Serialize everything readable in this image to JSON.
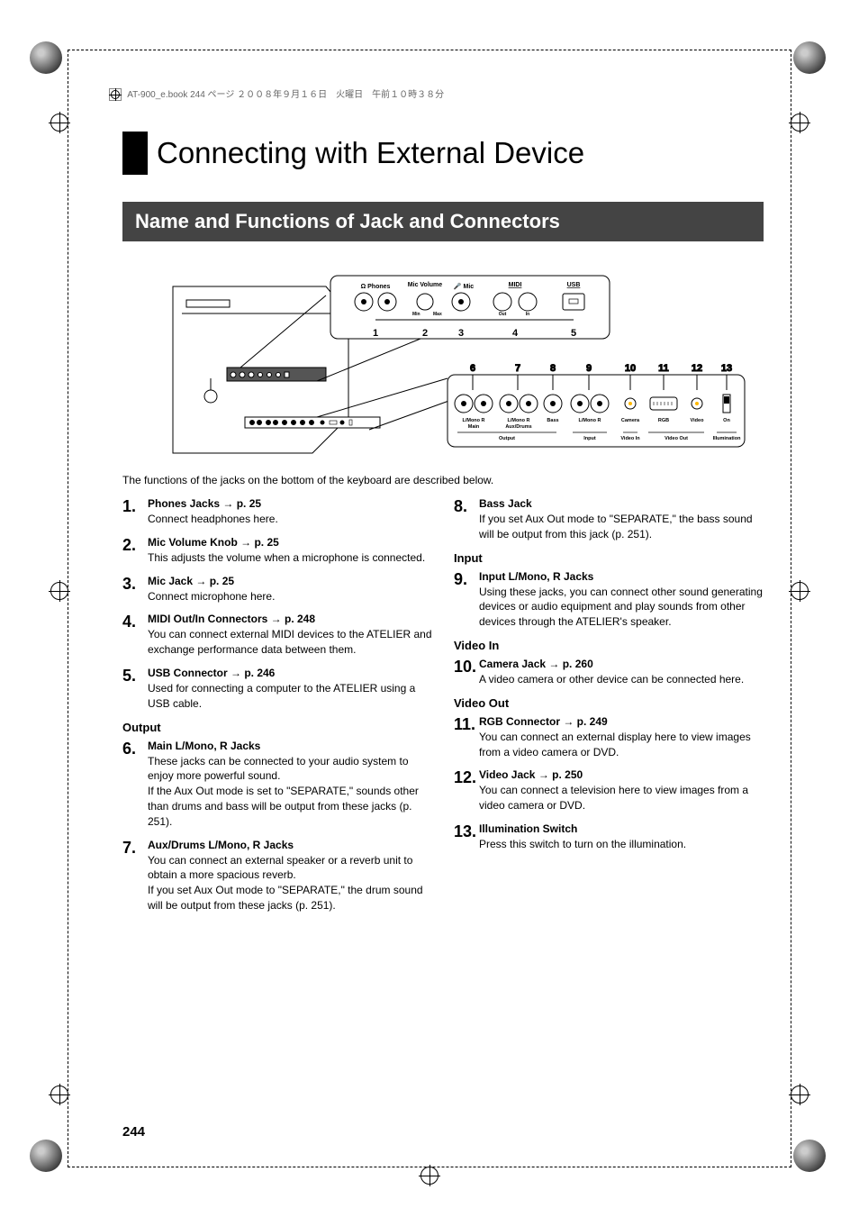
{
  "header": "AT-900_e.book  244 ページ  ２００８年９月１６日　火曜日　午前１０時３８分",
  "chapterTitle": "Connecting with External Device",
  "sectionBanner": "Name and Functions of Jack and Connectors",
  "diagram": {
    "topLabels": [
      "Phones",
      "Mic Volume",
      "Mic",
      "MIDI",
      "USB"
    ],
    "topNumbers": [
      "1",
      "2",
      "3",
      "4",
      "5"
    ],
    "bottomNumbers": [
      "6",
      "7",
      "8",
      "9",
      "10",
      "11",
      "12",
      "13"
    ],
    "bottomLabels": {
      "main": "L/Mono    R",
      "mainSub": "Main",
      "aux": "L/Mono    R",
      "auxSub": "Aux/Drums",
      "bass": "Bass",
      "input": "L/Mono    R",
      "camera": "Camera",
      "rgb": "RGB",
      "video": "Video",
      "illum": "On",
      "outputGroup": "Output",
      "inputGroup": "Input",
      "videoIn": "Video In",
      "videoOut": "Video Out",
      "illumination": "Illumination"
    }
  },
  "caption": "The functions of the jacks on the bottom of the keyboard are described below.",
  "leftItems": [
    {
      "num": "1.",
      "title": "Phones Jacks → p. 25",
      "desc": "Connect headphones here."
    },
    {
      "num": "2.",
      "title": "Mic Volume Knob → p. 25",
      "desc": "This adjusts the volume when a microphone is connected."
    },
    {
      "num": "3.",
      "title": "Mic Jack → p. 25",
      "desc": "Connect microphone here."
    },
    {
      "num": "4.",
      "title": "MIDI Out/In Connectors → p. 248",
      "desc": "You can connect external MIDI devices to the ATELIER and exchange performance data between them."
    },
    {
      "num": "5.",
      "title": "USB Connector → p. 246",
      "desc": "Used for connecting a computer to the ATELIER using a USB cable."
    }
  ],
  "leftGroup": "Output",
  "leftItems2": [
    {
      "num": "6.",
      "title": "Main L/Mono, R Jacks",
      "desc": "These jacks can be connected to your audio system to enjoy more powerful sound.\nIf the Aux Out mode is set to \"SEPARATE,\" sounds other than drums and bass will be output from these jacks (p. 251)."
    },
    {
      "num": "7.",
      "title": "Aux/Drums L/Mono, R Jacks",
      "desc": "You can connect an external speaker or a reverb unit to obtain a more spacious reverb.\nIf you set Aux Out mode to \"SEPARATE,\" the drum sound will be output from these jacks (p. 251)."
    }
  ],
  "rightItems1": [
    {
      "num": "8.",
      "title": "Bass Jack",
      "desc": "If you set Aux Out mode to \"SEPARATE,\" the bass sound will be output from this jack (p. 251)."
    }
  ],
  "rightGroup1": "Input",
  "rightItems2": [
    {
      "num": "9.",
      "title": "Input L/Mono, R Jacks",
      "desc": "Using these jacks, you can connect other sound generating devices or audio equipment and play sounds from other devices through the ATELIER's speaker."
    }
  ],
  "rightGroup2": "Video In",
  "rightItems3": [
    {
      "num": "10.",
      "title": "Camera Jack → p. 260",
      "desc": "A video camera or other device can be connected here."
    }
  ],
  "rightGroup3": "Video Out",
  "rightItems4": [
    {
      "num": "11.",
      "title": "RGB Connector → p. 249",
      "desc": "You can connect an external display here to view images from a video camera or DVD."
    },
    {
      "num": "12.",
      "title": "Video Jack → p. 250",
      "desc": "You can connect a television here to view images from a video camera or DVD."
    },
    {
      "num": "13.",
      "title": "Illumination Switch",
      "desc": "Press this switch to turn on the illumination."
    }
  ],
  "pageNumber": "244"
}
